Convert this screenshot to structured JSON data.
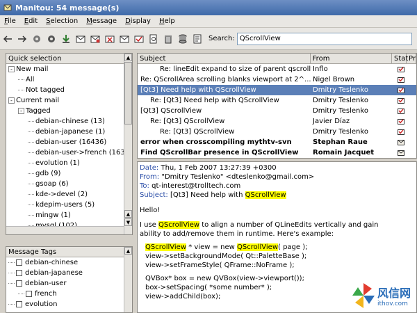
{
  "window": {
    "title": "Manitou: 54 message(s)"
  },
  "menu": [
    "File",
    "Edit",
    "Selection",
    "Message",
    "Display",
    "Help"
  ],
  "toolbar": {
    "icons": [
      "back-arrow-icon",
      "forward-arrow-icon",
      "gear-icon",
      "gear-icon",
      "download-icon",
      "mail-icon",
      "mail-reply-icon",
      "mail-delete-icon",
      "mail-move-icon",
      "mail-check-icon",
      "search-doc-icon",
      "trash-icon",
      "database-icon",
      "notes-icon"
    ],
    "search_label": "Search:",
    "search_value": "QScrollView"
  },
  "quick_selection": {
    "header": "Quick selection",
    "items": [
      {
        "label": "New mail",
        "level": 0,
        "exp": "-"
      },
      {
        "label": "All",
        "level": 1,
        "exp": ""
      },
      {
        "label": "Not tagged",
        "level": 1,
        "exp": ""
      },
      {
        "label": "Current mail",
        "level": 0,
        "exp": "-"
      },
      {
        "label": "Tagged",
        "level": 1,
        "exp": "-"
      },
      {
        "label": "debian-chinese (13)",
        "level": 2,
        "exp": ""
      },
      {
        "label": "debian-japanese (1)",
        "level": 2,
        "exp": ""
      },
      {
        "label": "debian-user (16436)",
        "level": 2,
        "exp": ""
      },
      {
        "label": "debian-user->french (163",
        "level": 2,
        "exp": ""
      },
      {
        "label": "evolution (1)",
        "level": 2,
        "exp": ""
      },
      {
        "label": "gdb (9)",
        "level": 2,
        "exp": ""
      },
      {
        "label": "gsoap (6)",
        "level": 2,
        "exp": ""
      },
      {
        "label": "kde->devel (2)",
        "level": 2,
        "exp": ""
      },
      {
        "label": "kdepim-users (5)",
        "level": 2,
        "exp": ""
      },
      {
        "label": "mingw (1)",
        "level": 2,
        "exp": ""
      },
      {
        "label": "mysql (102)",
        "level": 2,
        "exp": ""
      }
    ]
  },
  "message_tags": {
    "header": "Message Tags",
    "items": [
      {
        "label": "debian-chinese",
        "level": 0
      },
      {
        "label": "debian-japanese",
        "level": 0
      },
      {
        "label": "debian-user",
        "level": 0
      },
      {
        "label": "french",
        "level": 1
      },
      {
        "label": "evolution",
        "level": 0
      }
    ]
  },
  "message_list": {
    "columns": [
      "Subject",
      "From",
      "Stat",
      "Pr"
    ],
    "rows": [
      {
        "subject": "Re: lineEdit expand to size of parent qscrollv...",
        "from": "Inflo",
        "indent": 2,
        "bold": false,
        "selected": false,
        "status": "replied"
      },
      {
        "subject": "Re: QScrollArea scrolling blanks viewport at 2^...",
        "from": "Nigel Brown",
        "indent": 0,
        "bold": false,
        "selected": false,
        "status": "replied"
      },
      {
        "subject": "[Qt3] Need help with QScrollView",
        "from": "Dmitry Teslenko",
        "indent": 0,
        "bold": false,
        "selected": true,
        "status": "replied"
      },
      {
        "subject": "Re: [Qt3] Need help with QScrollView",
        "from": "Dmitry Teslenko",
        "indent": 1,
        "bold": false,
        "selected": false,
        "status": "replied"
      },
      {
        "subject": "[Qt3] QScrollView",
        "from": "Dmitry Teslenko",
        "indent": 0,
        "bold": false,
        "selected": false,
        "status": "replied"
      },
      {
        "subject": "Re: [Qt3] QScrollView",
        "from": "Javier Díaz",
        "indent": 1,
        "bold": false,
        "selected": false,
        "status": "replied"
      },
      {
        "subject": "Re: [Qt3] QScrollView",
        "from": "Dmitry Teslenko",
        "indent": 2,
        "bold": false,
        "selected": false,
        "status": "replied"
      },
      {
        "subject": "error when crosscompiling mythtv-svn",
        "from": "Stephan Raue",
        "indent": 0,
        "bold": true,
        "selected": false,
        "status": "unread"
      },
      {
        "subject": "Find QScrollBar presence in QScrollView",
        "from": "Romain Jacquet",
        "indent": 0,
        "bold": true,
        "selected": false,
        "status": "unread"
      }
    ]
  },
  "preview": {
    "date_key": "Date:",
    "date": "Thu, 1 Feb 2007 13:27:39 +0300",
    "from_key": "From:",
    "from": "\"Dmitry Teslenko\" <dteslenko@gmail.com>",
    "to_key": "To:",
    "to": "qt-interest@trolltech.com",
    "subject_key": "Subject:",
    "subject_pre": "[Qt3] Need help with ",
    "subject_hl": "QScrollView",
    "greeting": "Hello!",
    "p1_a": "I use ",
    "p1_hl": "QScrollView",
    "p1_b": " to align a number of QLineEdits vertically and gain",
    "p1_c": "ability to add/remove them in runtime. Here's example:",
    "code1_hl1": "QScrollView",
    "code1_mid": " * view = new ",
    "code1_hl2": "QScrollView",
    "code1_end": "( page );",
    "code2": "view->setBackgroundMode( Qt::PaletteBase );",
    "code3": "view->setFrameStyle( QFrame::NoFrame );",
    "code4": "QVBox* box = new QVBox(view->viewport());",
    "code5": "box->setSpacing( *some number* );",
    "code6": "view->addChild(box);"
  },
  "watermark": {
    "cn": "风信网",
    "url": "ithov.com"
  }
}
